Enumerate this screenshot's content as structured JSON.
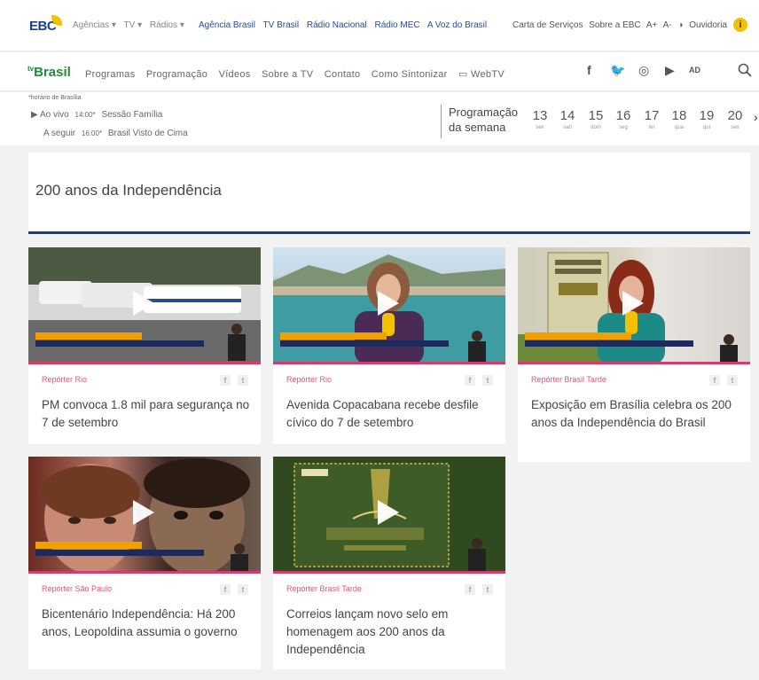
{
  "topbar": {
    "logo": "EBC",
    "gray_links": [
      "Agências ▾",
      "TV ▾",
      "Rádios ▾"
    ],
    "blue_links": [
      "Agência Brasil",
      "TV Brasil",
      "Rádio Nacional",
      "Rádio MEC",
      "A Voz do Brasil"
    ],
    "right_links": [
      "Carta de Serviços",
      "Sobre a EBC",
      "A+",
      "A-",
      "◑",
      "Ouvidoria"
    ]
  },
  "tvnav": {
    "logo_small": "tv",
    "logo": "Brasil",
    "menu": [
      "Programas",
      "Programação",
      "Vídeos",
      "Sobre a TV",
      "Contato",
      "Como Sintonizar",
      "▭ WebTV"
    ],
    "social": [
      "f",
      "🐦",
      "◎",
      "▶",
      "AD"
    ]
  },
  "schedule": {
    "timezone": "*horário de Brasília",
    "now_label": "Ao vivo",
    "now_time": "14:00*",
    "now_title": "Sessão Família",
    "next_label": "A seguir",
    "next_time": "16:00*",
    "next_title": "Brasil Visto de Cima",
    "week_label_1": "Programação",
    "week_label_2": "da semana",
    "days": [
      {
        "n": "13",
        "w": "sex"
      },
      {
        "n": "14",
        "w": "sab"
      },
      {
        "n": "15",
        "w": "dom"
      },
      {
        "n": "16",
        "w": "seg"
      },
      {
        "n": "17",
        "w": "ter"
      },
      {
        "n": "18",
        "w": "qua"
      },
      {
        "n": "19",
        "w": "qui"
      },
      {
        "n": "20",
        "w": "sex"
      }
    ]
  },
  "page": {
    "title": "200 anos da Independência"
  },
  "cards": [
    {
      "program": "Repórter Rio",
      "headline": "PM convoca 1.8 mil para segurança no 7 de setembro"
    },
    {
      "program": "Repórter Rio",
      "headline": "Avenida Copacabana recebe desfile cívico do 7 de setembro"
    },
    {
      "program": "Repórter Brasil Tarde",
      "headline": "Exposição em Brasília celebra os 200 anos da Independência do Brasil"
    },
    {
      "program": "Repórter São Paulo",
      "headline": "Bicentenário Independência: Há 200 anos, Leopoldina assumia o governo"
    },
    {
      "program": "Repórter Brasil Tarde",
      "headline": "Correios lançam novo selo em homenagem aos 200 anos da Independência"
    }
  ],
  "share": {
    "facebook": "f",
    "twitter": "t"
  },
  "colors": {
    "brand_blue": "#1b3f8f",
    "brand_green": "#1e8a3a",
    "accent_pink": "#d63c6a",
    "accent_yellow": "#f2c200"
  }
}
